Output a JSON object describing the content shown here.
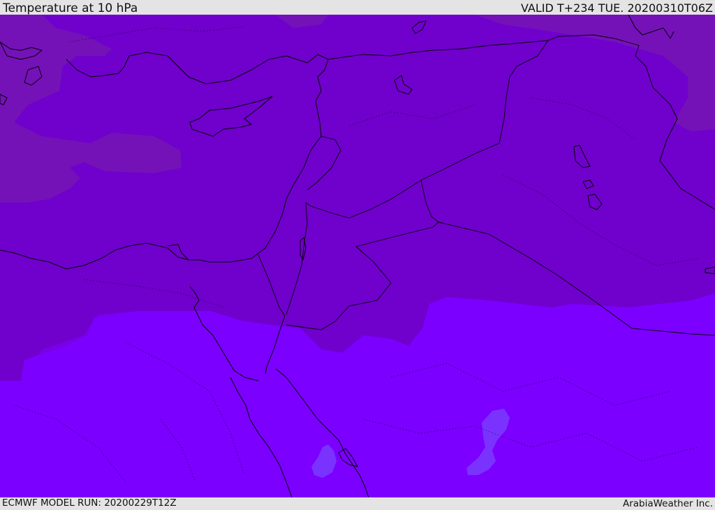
{
  "header": {
    "title": "Temperature at 10 hPa",
    "valid": "VALID T+234 TUE. 20200310T06Z"
  },
  "footer": {
    "model_run": "ECMWF MODEL RUN: 20200229T12Z",
    "credit": "ArabiaWeather Inc."
  },
  "map": {
    "colors": {
      "land_base": "#7a00e6",
      "cold_region": "#7000c8",
      "coldest_region": "#7412b8",
      "warm_region": "#7b00ff",
      "warmest_patch": "#7a33ff",
      "coastline": "#000000"
    }
  }
}
